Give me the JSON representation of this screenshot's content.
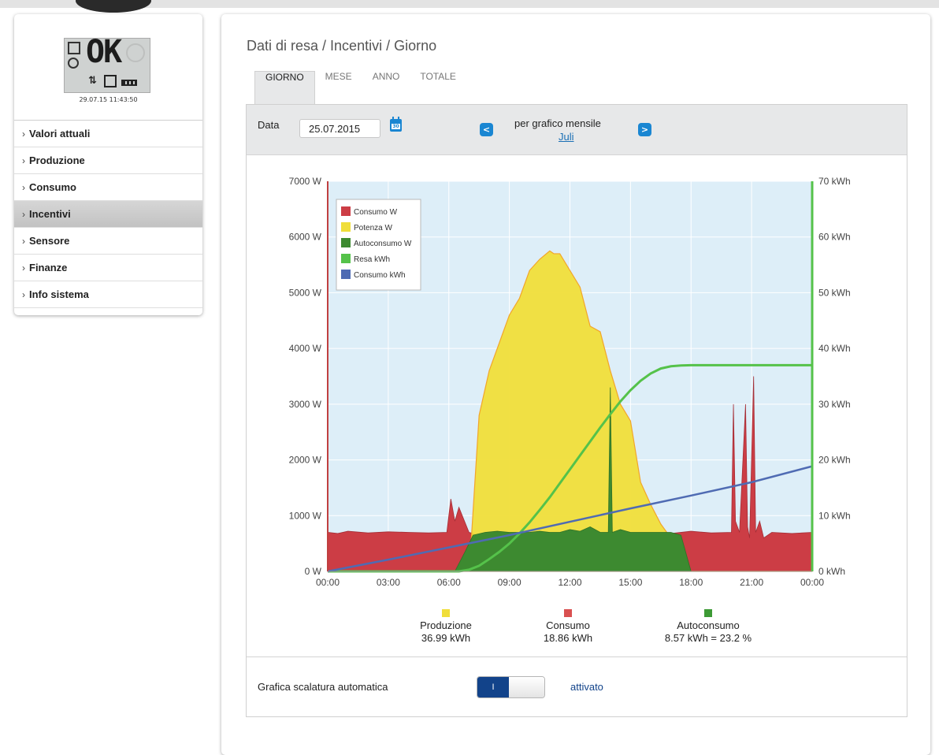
{
  "device": {
    "lcd_text": "OK",
    "timestamp": "29.07.15 11:43:50"
  },
  "sidebar": {
    "items": [
      {
        "label": "Valori attuali"
      },
      {
        "label": "Produzione"
      },
      {
        "label": "Consumo"
      },
      {
        "label": "Incentivi",
        "active": true
      },
      {
        "label": "Sensore"
      },
      {
        "label": "Finanze"
      },
      {
        "label": "Info sistema"
      }
    ]
  },
  "page": {
    "title": "Dati di resa / Incentivi / Giorno",
    "tabs": [
      {
        "label": "GIORNO",
        "active": true
      },
      {
        "label": "MESE"
      },
      {
        "label": "ANNO"
      },
      {
        "label": "TOTALE"
      }
    ]
  },
  "controls": {
    "date_label": "Data",
    "date_value": "25.07.2015",
    "calendar_icon": "calendar-icon",
    "month_label": "per grafico mensile",
    "month_link": "Juli"
  },
  "summary": {
    "produzione": {
      "label": "Produzione",
      "value": "36.99 kWh",
      "color": "#f0de3a"
    },
    "consumo": {
      "label": "Consumo",
      "value": "18.86 kWh",
      "color": "#d95050"
    },
    "autoconsumo": {
      "label": "Autoconsumo",
      "value": "8.57 kWh = 23.2 %",
      "color": "#3d9a35"
    }
  },
  "settings": {
    "autoscale_label": "Grafica scalatura automatica",
    "toggle_on": "I",
    "status": "attivato"
  },
  "chart_data": {
    "type": "area",
    "x_ticks": [
      "00:00",
      "03:00",
      "06:00",
      "09:00",
      "12:00",
      "15:00",
      "18:00",
      "21:00",
      "00:00"
    ],
    "left_axis": {
      "ticks": [
        "0 W",
        "1000 W",
        "2000 W",
        "3000 W",
        "4000 W",
        "5000 W",
        "6000 W",
        "7000 W"
      ],
      "range": [
        0,
        7000
      ]
    },
    "right_axis": {
      "ticks": [
        "0 kWh",
        "10 kWh",
        "20 kWh",
        "30 kWh",
        "40 kWh",
        "50 kWh",
        "60 kWh",
        "70 kWh"
      ],
      "range": [
        0,
        70
      ]
    },
    "series": [
      {
        "name": "Consumo W",
        "color": "#cc3d45",
        "x": [
          0,
          0.5,
          1,
          2,
          3,
          4,
          5,
          5.9,
          6.1,
          6.3,
          6.5,
          7,
          7.5,
          8,
          9,
          10,
          11,
          12,
          13,
          14,
          15,
          16,
          17,
          18,
          19,
          20,
          20.1,
          20.2,
          20.4,
          20.7,
          20.8,
          20.9,
          21.1,
          21.2,
          21.4,
          21.6,
          22,
          23,
          24
        ],
        "y": [
          700,
          680,
          720,
          690,
          710,
          700,
          690,
          700,
          1300,
          900,
          1150,
          700,
          650,
          700,
          650,
          700,
          650,
          700,
          680,
          700,
          650,
          700,
          680,
          720,
          690,
          700,
          3000,
          900,
          700,
          3000,
          800,
          600,
          3500,
          700,
          900,
          600,
          700,
          680,
          700
        ]
      },
      {
        "name": "Potenza W",
        "color": "#f0de3a",
        "x": [
          0,
          6.9,
          7.1,
          7.5,
          8,
          8.5,
          9,
          9.5,
          10,
          10.5,
          11,
          11.2,
          11.5,
          12,
          12.5,
          13,
          13.5,
          14,
          14.5,
          15,
          15.5,
          16,
          16.5,
          17,
          17.5,
          18,
          24
        ],
        "y": [
          0,
          0,
          500,
          2800,
          3600,
          4100,
          4600,
          4900,
          5400,
          5600,
          5750,
          5700,
          5700,
          5400,
          5100,
          4400,
          4300,
          3600,
          3000,
          2700,
          1600,
          1200,
          850,
          600,
          400,
          0,
          0
        ]
      },
      {
        "name": "Autoconsumo W",
        "color": "#3d8a30",
        "x": [
          0,
          6.3,
          6.8,
          7.2,
          7.8,
          8.4,
          9,
          10,
          10.5,
          11,
          11.5,
          12,
          12.5,
          13,
          13.5,
          13.9,
          14.0,
          14.1,
          14.5,
          15,
          16,
          17,
          17.5,
          18,
          24
        ],
        "y": [
          0,
          0,
          350,
          650,
          700,
          720,
          700,
          700,
          720,
          700,
          700,
          750,
          720,
          800,
          700,
          700,
          3300,
          700,
          750,
          700,
          700,
          700,
          650,
          0,
          0
        ]
      },
      {
        "name": "Resa kWh",
        "color": "#55c24a",
        "x": [
          0,
          6.5,
          7,
          7.5,
          8,
          8.5,
          9,
          9.5,
          10,
          10.5,
          11,
          11.5,
          12,
          12.5,
          13,
          13.5,
          14,
          14.5,
          15,
          15.5,
          16,
          16.5,
          17,
          17.5,
          18,
          24
        ],
        "y": [
          0,
          0,
          0.3,
          1,
          2.2,
          3.5,
          5,
          6.8,
          8.8,
          11,
          13.3,
          15.8,
          18.3,
          20.8,
          23.3,
          25.8,
          28.2,
          30.5,
          32.5,
          34.2,
          35.5,
          36.4,
          36.8,
          36.95,
          36.99,
          36.99
        ]
      },
      {
        "name": "Consumo kWh",
        "color": "#4f6bb3",
        "x": [
          0,
          3,
          6,
          9,
          12,
          15,
          18,
          21,
          24
        ],
        "y": [
          0,
          2.1,
          4.3,
          6.5,
          8.9,
          11.3,
          13.6,
          16,
          18.86
        ]
      }
    ],
    "x_range": [
      0,
      24
    ],
    "legend_position": "top-left",
    "grid": true
  }
}
